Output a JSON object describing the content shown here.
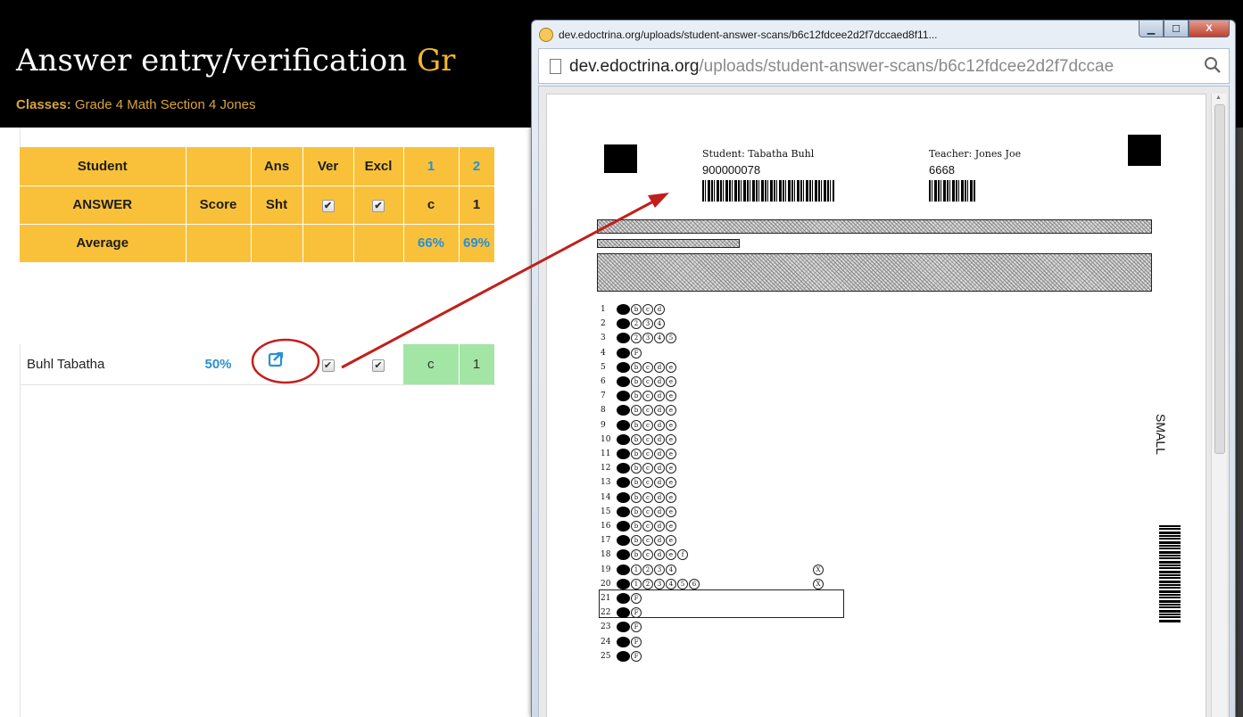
{
  "page": {
    "title_main": "Answer entry/verification",
    "title_accent": "Gr",
    "classes_label": "Classes:",
    "classes_value": "Grade 4 Math Section 4 Jones"
  },
  "grid": {
    "header_row1": {
      "student": "Student",
      "score": "",
      "ans": "Ans",
      "ver": "Ver",
      "excl": "Excl",
      "q1": "1",
      "q2": "2"
    },
    "header_row2": {
      "student": "ANSWER",
      "score": "Score",
      "ans": "Sht",
      "ver_check": "✔",
      "excl_check": "✔",
      "q1": "c",
      "q2": "1"
    },
    "header_row3": {
      "student": "Average",
      "q1": "66%",
      "q2": "69%"
    },
    "students": [
      {
        "name": "Buhl Tabatha",
        "score": "50%",
        "ver_check": "✔",
        "excl_check": "✔",
        "q1": "c",
        "q2": "1"
      }
    ]
  },
  "popup": {
    "title": "dev.edoctrina.org/uploads/student-answer-scans/b6c12fdcee2d2f7dccaed8f11...",
    "url_domain": "dev.edoctrina.org",
    "url_path": "/uploads/student-answer-scans/b6c12fdcee2d2f7dccae",
    "buttons": {
      "minimize": "▁",
      "maximize": "☐",
      "close": "X"
    }
  },
  "scan": {
    "student_line": "Student: Tabatha Buhl",
    "student_id": "900000078",
    "teacher_line": "Teacher: Jones Joe",
    "teacher_id": "6668",
    "side_label": "SMALL",
    "rows": [
      {
        "n": "1",
        "opts": [
          "b",
          "c",
          "d"
        ]
      },
      {
        "n": "2",
        "opts": [
          "2",
          "3",
          "4"
        ]
      },
      {
        "n": "3",
        "opts": [
          "2",
          "3",
          "4",
          "5"
        ]
      },
      {
        "n": "4",
        "opts": [
          "F"
        ]
      },
      {
        "n": "5",
        "opts": [
          "b",
          "c",
          "d",
          "e"
        ]
      },
      {
        "n": "6",
        "opts": [
          "b",
          "c",
          "d",
          "e"
        ]
      },
      {
        "n": "7",
        "opts": [
          "b",
          "c",
          "d",
          "e"
        ]
      },
      {
        "n": "8",
        "opts": [
          "b",
          "c",
          "d",
          "e"
        ]
      },
      {
        "n": "9",
        "opts": [
          "b",
          "c",
          "d",
          "e"
        ]
      },
      {
        "n": "10",
        "opts": [
          "b",
          "c",
          "d",
          "e"
        ]
      },
      {
        "n": "11",
        "opts": [
          "b",
          "c",
          "d",
          "e"
        ]
      },
      {
        "n": "12",
        "opts": [
          "b",
          "c",
          "d",
          "e"
        ]
      },
      {
        "n": "13",
        "opts": [
          "b",
          "c",
          "d",
          "e"
        ]
      },
      {
        "n": "14",
        "opts": [
          "b",
          "c",
          "d",
          "e"
        ]
      },
      {
        "n": "15",
        "opts": [
          "b",
          "c",
          "d",
          "e"
        ]
      },
      {
        "n": "16",
        "opts": [
          "b",
          "c",
          "d",
          "e"
        ]
      },
      {
        "n": "17",
        "opts": [
          "b",
          "c",
          "d",
          "e"
        ]
      },
      {
        "n": "18",
        "opts": [
          "b",
          "c",
          "d",
          "e",
          "f"
        ]
      },
      {
        "n": "19",
        "opts": [
          "1",
          "2",
          "3",
          "4"
        ],
        "x": "X"
      },
      {
        "n": "20",
        "opts": [
          "1",
          "2",
          "3",
          "4",
          "5",
          "6"
        ],
        "x": "X"
      },
      {
        "n": "21",
        "opts": [
          "F"
        ]
      },
      {
        "n": "22",
        "opts": [
          "F"
        ]
      },
      {
        "n": "23",
        "opts": [
          "F"
        ]
      },
      {
        "n": "24",
        "opts": [
          "F"
        ]
      },
      {
        "n": "25",
        "opts": [
          "F"
        ]
      }
    ]
  },
  "colors": {
    "header_bg": "#000000",
    "accent": "#f5b72c",
    "grid_yellow": "#f9c13a",
    "link_blue": "#2a8fd4",
    "answer_green": "#a2e5a4",
    "annotation_red": "#c0201c"
  }
}
